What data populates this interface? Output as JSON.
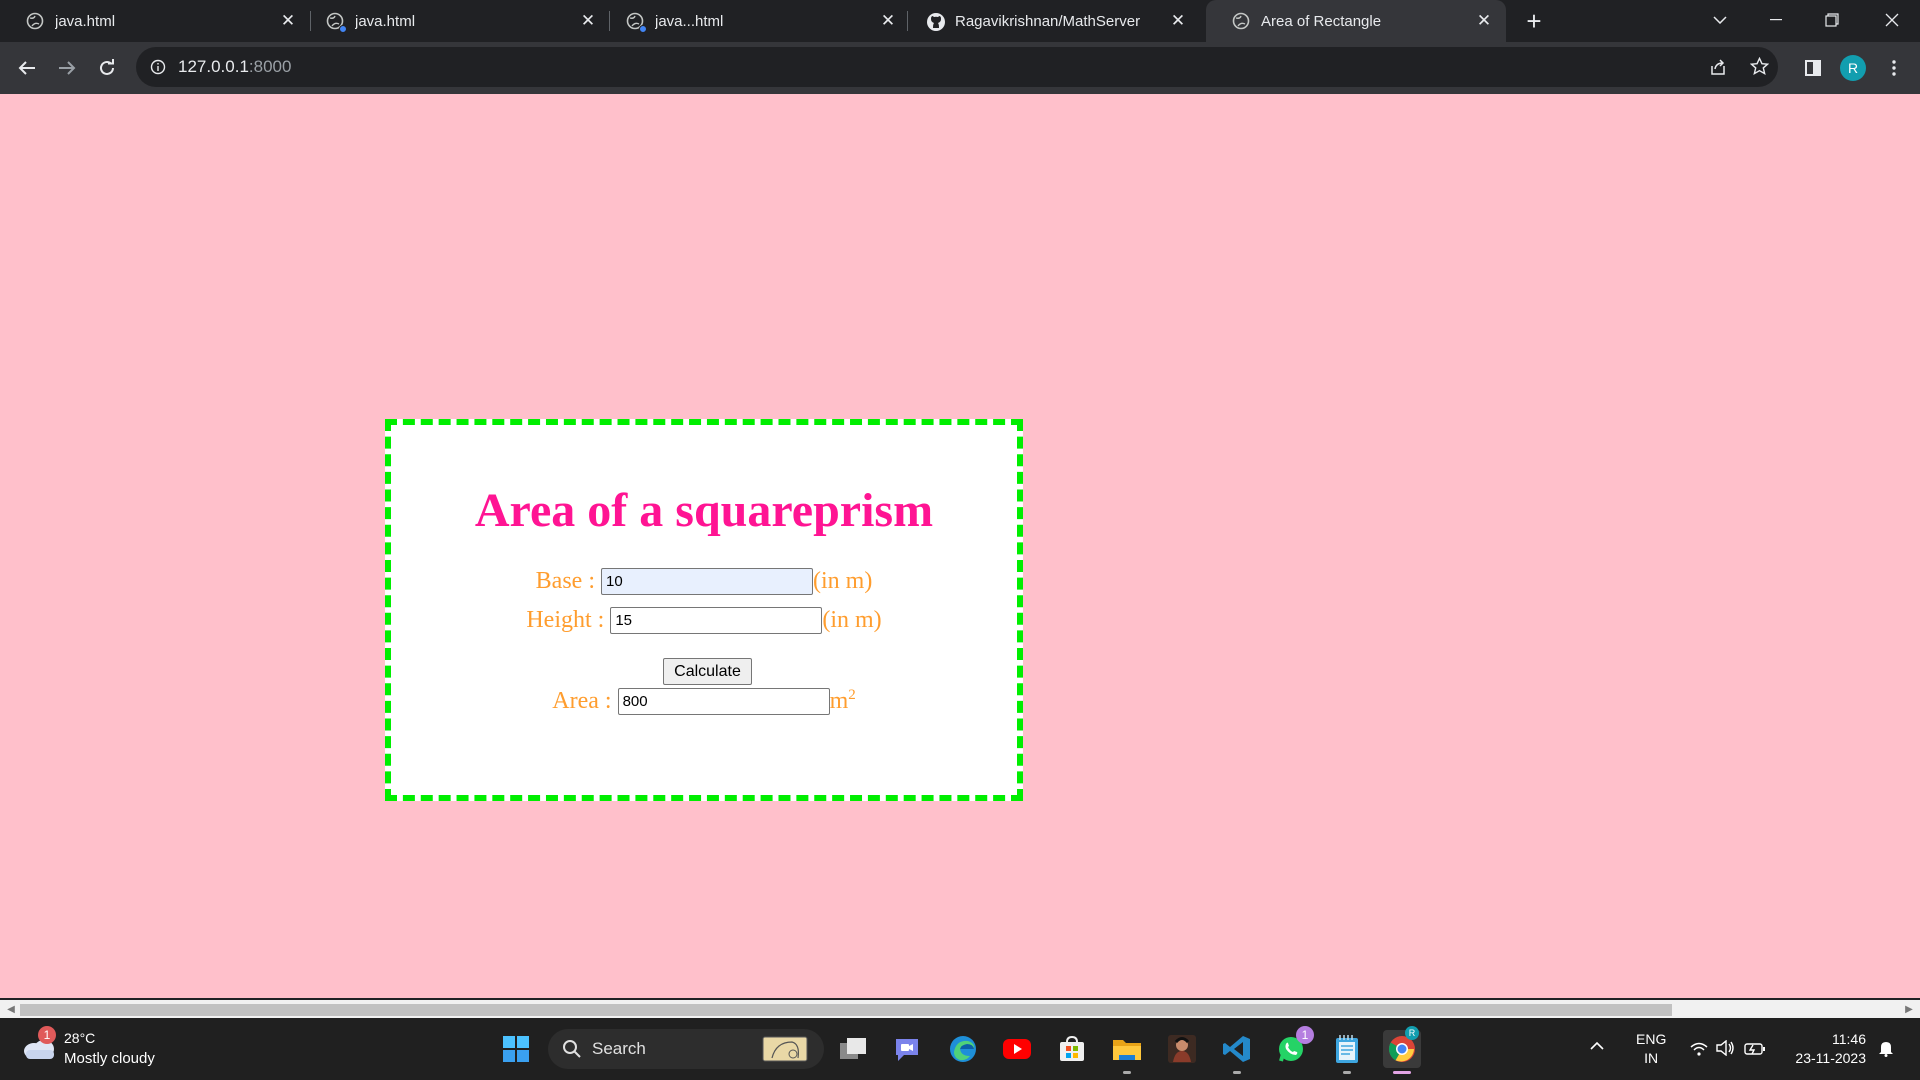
{
  "browser": {
    "tabs": [
      {
        "title": "java.html",
        "icon": "globe-icon"
      },
      {
        "title": "java.html",
        "icon": "globe-icon"
      },
      {
        "title": "java...html",
        "icon": "globe-icon"
      },
      {
        "title": "Ragavikrishnan/MathServer",
        "icon": "github-icon"
      },
      {
        "title": "Area of Rectangle",
        "icon": "globe-icon",
        "active": true
      }
    ],
    "url_host": "127.0.0.1",
    "url_port": ":8000",
    "profile_initial": "R"
  },
  "page": {
    "heading": "Area of a squareprism",
    "base_label": "Base :",
    "base_value": "10",
    "base_unit": "(in m)",
    "height_label": "Height :",
    "height_value": "15",
    "height_unit": "(in m)",
    "calculate_label": "Calculate",
    "area_label": "Area :",
    "area_value": "800",
    "area_unit_base": "m",
    "area_unit_exp": "2",
    "colors": {
      "background": "#ffc0cb",
      "border": "#00ee00",
      "heading": "#ff1493",
      "labels": "#ff9d2e"
    }
  },
  "taskbar": {
    "weather_temp": "28°C",
    "weather_condition": "Mostly cloudy",
    "weather_badge": "1",
    "search_label": "Search",
    "whatsapp_badge": "1",
    "lang_line1": "ENG",
    "lang_line2": "IN",
    "time": "11:46",
    "date": "23-11-2023"
  }
}
